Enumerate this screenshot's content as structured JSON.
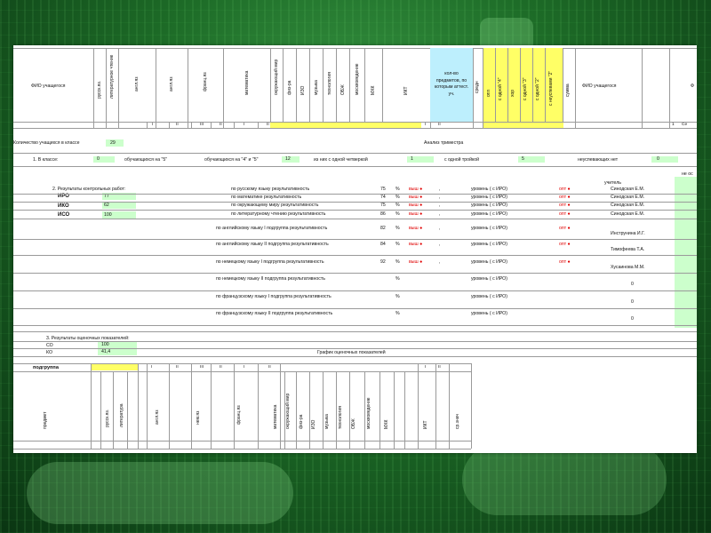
{
  "header": {
    "fio_label": "ФИО учащегося",
    "subjects": [
      "русск.яз.",
      "литературное чтение",
      "англ.яз",
      "англ.яз",
      "франц.яз",
      "математика",
      "окружающий мир",
      "физ-ра",
      "ИЗО",
      "музыка",
      "технология",
      "ОБЖ",
      "москвоведение",
      "МХК",
      "ИКТ"
    ],
    "kolvo_label": "кол-во предметов, по которым аттест. уч.",
    "sredn": "средн",
    "otl": "отл",
    "s_odnoy_4": "с одной \"4\"",
    "hor": "хор",
    "s_odnoy_3": "с одной \"3\"",
    "s_odnoy_2": "с одной \"2\"",
    "s_neuspev": "с неуспевами \"2\"",
    "summa": "сумма",
    "fio_label2": "ФИО учащегося",
    "right_cut": "Ф",
    "roman_row": [
      "I",
      "II",
      "III",
      "II",
      "I",
      "II",
      "I",
      "II"
    ],
    "right_nums": [
      "1",
      "Се"
    ]
  },
  "summary": {
    "kolvo_label": "Количество учащихся в классе",
    "kolvo_value": "29",
    "analiz_label": "Анализ триместра",
    "in_class_label": "1.   В классе:",
    "in_class_value": "0",
    "na5_label": "обучающихся на \"5\"",
    "na45_label": "обучающихся на \"4\" и \"5\"",
    "na45_value": "12",
    "odna4_label": "из них с одной четверкой",
    "odna4_value": "1",
    "odna3_label": "с одной тройкой",
    "odna3_value": "5",
    "neusp_label": "неуспевающих нет",
    "neusp_value": "0",
    "right_cut": "не ос"
  },
  "results": {
    "title": "2. Результаты контрольных работ:",
    "teacher_label": "учитель",
    "indices": [
      {
        "name": "ИРО",
        "value": "77"
      },
      {
        "name": "ИКО",
        "value": "62"
      },
      {
        "name": "ИСО",
        "value": "100"
      }
    ],
    "rows": [
      {
        "label": "по русскому языку результативность",
        "value": "75",
        "pct": "%",
        "vys": "выш",
        "level": "уровень ( с ИРО)",
        "opt": "опт",
        "teacher": "Синодская Е.М."
      },
      {
        "label": "по математике результативность",
        "value": "74",
        "pct": "%",
        "vys": "выш",
        "level": "уровень ( с ИРО)",
        "opt": "опт",
        "teacher": "Синодская Е.М."
      },
      {
        "label": "по окружающему миру результативность",
        "value": "75",
        "pct": "%",
        "vys": "выш",
        "level": "уровень ( с ИРО)",
        "opt": "опт",
        "teacher": "Синодская Е.М."
      },
      {
        "label": "по литературному чтению результативность",
        "value": "86",
        "pct": "%",
        "vys": "выш",
        "level": "уровень ( с ИРО)",
        "opt": "опт",
        "teacher": "Синодская Е.М."
      },
      {
        "label": "по английскому языку I подгруппа  результативность",
        "value": "82",
        "pct": "%",
        "vys": "выш",
        "level": "уровень ( с ИРО)",
        "opt": "опт",
        "teacher": "Инструнина И.Г."
      },
      {
        "label": "по английскому языку II подгруппа  результативность",
        "value": "84",
        "pct": "%",
        "vys": "выш",
        "level": "уровень ( с ИРО)",
        "opt": "опт",
        "teacher": "Тимофеева Т.А."
      },
      {
        "label": "по немецкому языку I подгруппа  результативность",
        "value": "92",
        "pct": "%",
        "vys": "выш",
        "level": "уровень ( с ИРО)",
        "opt": "опт",
        "teacher": "Хусаинова М.М."
      },
      {
        "label": "по немецкому языку II подгруппа  результативность",
        "value": "",
        "pct": "%",
        "vys": "",
        "level": "уровень ( с ИРО)",
        "opt": "",
        "teacher": "0"
      },
      {
        "label": "по французскому языку I подгруппа  результативность",
        "value": "",
        "pct": "%",
        "vys": "",
        "level": "уровень ( с ИРО)",
        "opt": "",
        "teacher": "0"
      },
      {
        "label": "по французскому языку II подгруппа  результативность",
        "value": "",
        "pct": "%",
        "vys": "",
        "level": "уровень ( с ИРО)",
        "opt": "",
        "teacher": "0"
      }
    ]
  },
  "evaluation": {
    "title": "3. Результаты оценочных показателей:",
    "rows": [
      {
        "name": "СО",
        "value": "100"
      },
      {
        "name": "КО",
        "value": "41,4"
      }
    ],
    "chart_title": "График оценочных показателей"
  },
  "bottom": {
    "podgruppa_label": "подгруппа",
    "roman_row": [
      "I",
      "II",
      "III",
      "II",
      "I",
      "II"
    ],
    "roman_right": [
      "I",
      "II"
    ],
    "predmet_label": "предмет",
    "subjects": [
      "русск.яз.",
      "литература",
      "англ.яз",
      "нем.яз",
      "франц.яз",
      "математика",
      "окружающий мир",
      "физ-ра",
      "ИЗО",
      "музыка",
      "технология",
      "ОБЖ",
      "москвоведение",
      "МХК",
      "ИКТ",
      "ср.знач"
    ]
  },
  "colors": {
    "background": "#1d6b27",
    "yellow": "#ffff66",
    "light_green": "#ccffcc",
    "cyan": "#bdeffd",
    "red": "#e00000"
  }
}
